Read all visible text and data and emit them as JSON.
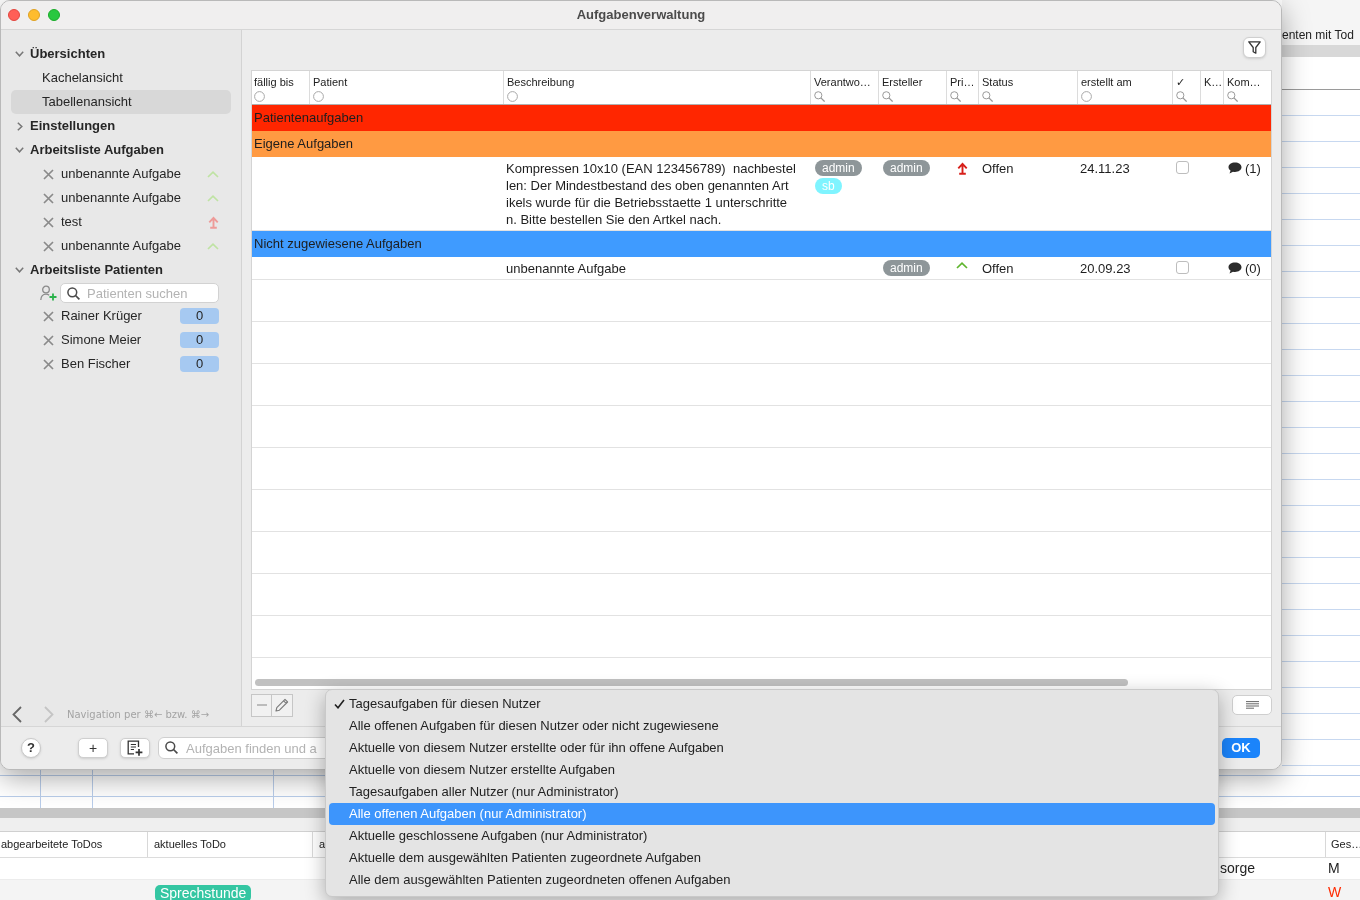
{
  "window": {
    "title": "Aufgabenverwaltung"
  },
  "sidebar": {
    "overviews": {
      "label": "Übersichten",
      "expanded": true,
      "items": [
        {
          "label": "Kachelansicht",
          "selected": false
        },
        {
          "label": "Tabellenansicht",
          "selected": true
        }
      ]
    },
    "settings": {
      "label": "Einstellungen",
      "expanded": false
    },
    "task_worklist": {
      "label": "Arbeitsliste Aufgaben",
      "expanded": true,
      "items": [
        {
          "label": "unbenannte Aufgabe",
          "high_priority": false
        },
        {
          "label": "unbenannte Aufgabe",
          "high_priority": false
        },
        {
          "label": "test",
          "high_priority": true
        },
        {
          "label": "unbenannte Aufgabe",
          "high_priority": false
        }
      ]
    },
    "patient_worklist": {
      "label": "Arbeitsliste Patienten",
      "expanded": true,
      "search": {
        "placeholder": "Patienten suchen"
      },
      "patients": [
        {
          "name": "Rainer Krüger",
          "count": "0"
        },
        {
          "name": "Simone Meier",
          "count": "0"
        },
        {
          "name": "Ben Fischer",
          "count": "0"
        }
      ]
    },
    "navigation": {
      "back": {
        "disabled": false
      },
      "forward": {
        "disabled": true
      },
      "hint": "Navigation per ⌘← bzw. ⌘→"
    }
  },
  "table": {
    "columns": [
      {
        "label": "fällig bis",
        "kind": "option"
      },
      {
        "label": "Patient",
        "kind": "option"
      },
      {
        "label": "Beschreibung",
        "kind": "option"
      },
      {
        "label": "Verantwo…",
        "kind": "search"
      },
      {
        "label": "Ersteller",
        "kind": "search"
      },
      {
        "label": "Pri…",
        "kind": "search"
      },
      {
        "label": "Status",
        "kind": "search"
      },
      {
        "label": "erstellt am",
        "kind": "option"
      },
      {
        "label": "✓",
        "kind": "search"
      },
      {
        "label": "K…",
        "kind": "plain"
      },
      {
        "label": "Kom…",
        "kind": "search"
      }
    ],
    "rows": [
      {
        "kind": "group",
        "label": "Patientenaufgaben",
        "color": "#ff2600"
      },
      {
        "kind": "group",
        "label": "Eigene Aufgaben",
        "color": "#ff9a42"
      },
      {
        "kind": "task",
        "description": "Kompressen 10x10 (EAN 123456789)  nachbestel\nlen: Der Mindestbestand des oben genannten Art\nikels wurde für die Betriebsstaette 1 unterschritte\nn. Bitte bestellen Sie den Artkel nach.",
        "responsible": [
          {
            "label": "admin",
            "color": "#8e9699"
          },
          {
            "label": "sb",
            "color": "#7ff4ff"
          }
        ],
        "creator": [
          {
            "label": "admin",
            "color": "#8e9699"
          }
        ],
        "high_priority": true,
        "status": "Offen",
        "created": "24.11.23",
        "done": false,
        "comments": "(1)"
      },
      {
        "kind": "group",
        "label": "Nicht zugewiesene Aufgaben",
        "color": "#3f9bff"
      },
      {
        "kind": "task",
        "description": "unbenannte Aufgabe",
        "creator": [
          {
            "label": "admin",
            "color": "#8e9699"
          }
        ],
        "high_priority": false,
        "status": "Offen",
        "created": "20.09.23",
        "done": false,
        "comments": "(0)"
      }
    ]
  },
  "toolbar": {
    "help": "?",
    "add": "+",
    "search": {
      "placeholder": "Aufgaben finden und a"
    },
    "ok": "OK"
  },
  "task_menu": {
    "items": [
      {
        "label": "Tagesaufgaben für diesen Nutzer",
        "checked": true,
        "highlighted": false
      },
      {
        "label": "Alle offenen Aufgaben für diesen Nutzer oder nicht zugewiesene",
        "checked": false,
        "highlighted": false
      },
      {
        "label": "Aktuelle von diesem Nutzer erstellte oder für ihn offene Aufgaben",
        "checked": false,
        "highlighted": false
      },
      {
        "label": "Aktuelle von diesem Nutzer erstellte Aufgaben",
        "checked": false,
        "highlighted": false
      },
      {
        "label": "Tagesaufgaben aller Nutzer (nur Administrator)",
        "checked": false,
        "highlighted": false
      },
      {
        "label": "Alle offenen Aufgaben (nur Administrator)",
        "checked": false,
        "highlighted": true
      },
      {
        "label": "Aktuelle geschlossene Aufgaben (nur Administrator)",
        "checked": false,
        "highlighted": false
      },
      {
        "label": "Aktuelle dem ausgewählten Patienten zugeordnete Aufgaben",
        "checked": false,
        "highlighted": false
      },
      {
        "label": "Alle dem ausgewählten Patienten zugeordneten offenen Aufgaben",
        "checked": false,
        "highlighted": false
      }
    ]
  },
  "background_window": {
    "header": "enten mit Tod",
    "table": {
      "columns": [
        "abgearbeitete ToDos",
        "aktuelles ToDo",
        "a",
        "Ges…"
      ],
      "rows": [
        {
          "column_4": "sorge",
          "ges": {
            "text": "M",
            "color": "#1d1d1d"
          }
        },
        {
          "aktuelles_todo": "Sprechstunde",
          "ges": {
            "text": "W",
            "color": "#ff2a00"
          }
        }
      ]
    }
  }
}
